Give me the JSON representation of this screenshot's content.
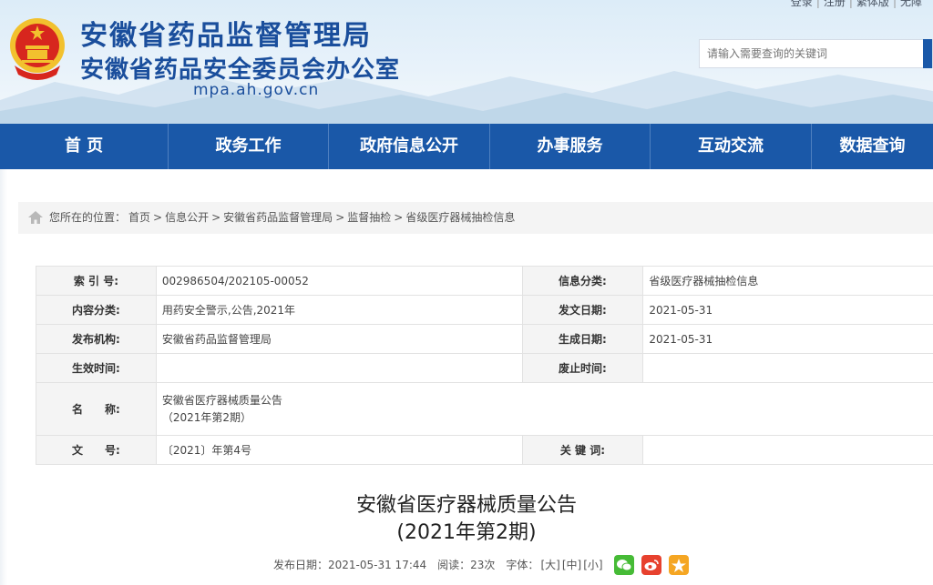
{
  "header": {
    "title": "安徽省药品监督管理局",
    "subtitle": "安徽省药品安全委员会办公室",
    "domain": "mpa.ah.gov.cn",
    "toplinks": [
      "登录",
      "注册",
      "繁体版",
      "无障"
    ],
    "search_placeholder": "请输入需要查询的关键词"
  },
  "nav": [
    "首 页",
    "政务工作",
    "政府信息公开",
    "办事服务",
    "互动交流",
    "数据查询"
  ],
  "breadcrumb": {
    "label": "您所在的位置：",
    "items": [
      "首页",
      "信息公开",
      "安徽省药品监督管理局",
      "监督抽检",
      "省级医疗器械抽检信息"
    ],
    "separator": ">"
  },
  "info": {
    "index_label": "索 引 号:",
    "index_value": "002986504/202105-00052",
    "category_label": "信息分类:",
    "category_value": "省级医疗器械抽检信息",
    "content_label": "内容分类:",
    "content_value": "用药安全警示,公告,2021年",
    "issue_date_label": "发文日期:",
    "issue_date_value": "2021-05-31",
    "publisher_label": "发布机构:",
    "publisher_value": "安徽省药品监督管理局",
    "created_label": "生成日期:",
    "created_value": "2021-05-31",
    "effective_label": "生效时间:",
    "effective_value": "",
    "expired_label": "废止时间:",
    "expired_value": "",
    "name_label": "名　　称:",
    "name_line1": "安徽省医疗器械质量公告",
    "name_line2": "（2021年第2期）",
    "doc_no_label": "文　　号:",
    "doc_no_value": "〔2021〕年第4号",
    "keywords_label": "关 键 词:",
    "keywords_value": ""
  },
  "article": {
    "title_line1": "安徽省医疗器械质量公告",
    "title_line2": "(2021年第2期)",
    "publish_date": "发布日期：2021-05-31 17:44",
    "views": "阅读：23次",
    "font_label": "字体：",
    "font_large": "[大]",
    "font_medium": "[中]",
    "font_small": "[小]"
  },
  "colors": {
    "brand_blue": "#1a58a8",
    "title_blue": "#1a4e9c",
    "wechat": "#46bb36",
    "weibo": "#e7412e",
    "qzone": "#f5a623"
  },
  "icons": [
    "national-emblem",
    "home-icon",
    "wechat-icon",
    "weibo-icon",
    "qzone-icon"
  ]
}
